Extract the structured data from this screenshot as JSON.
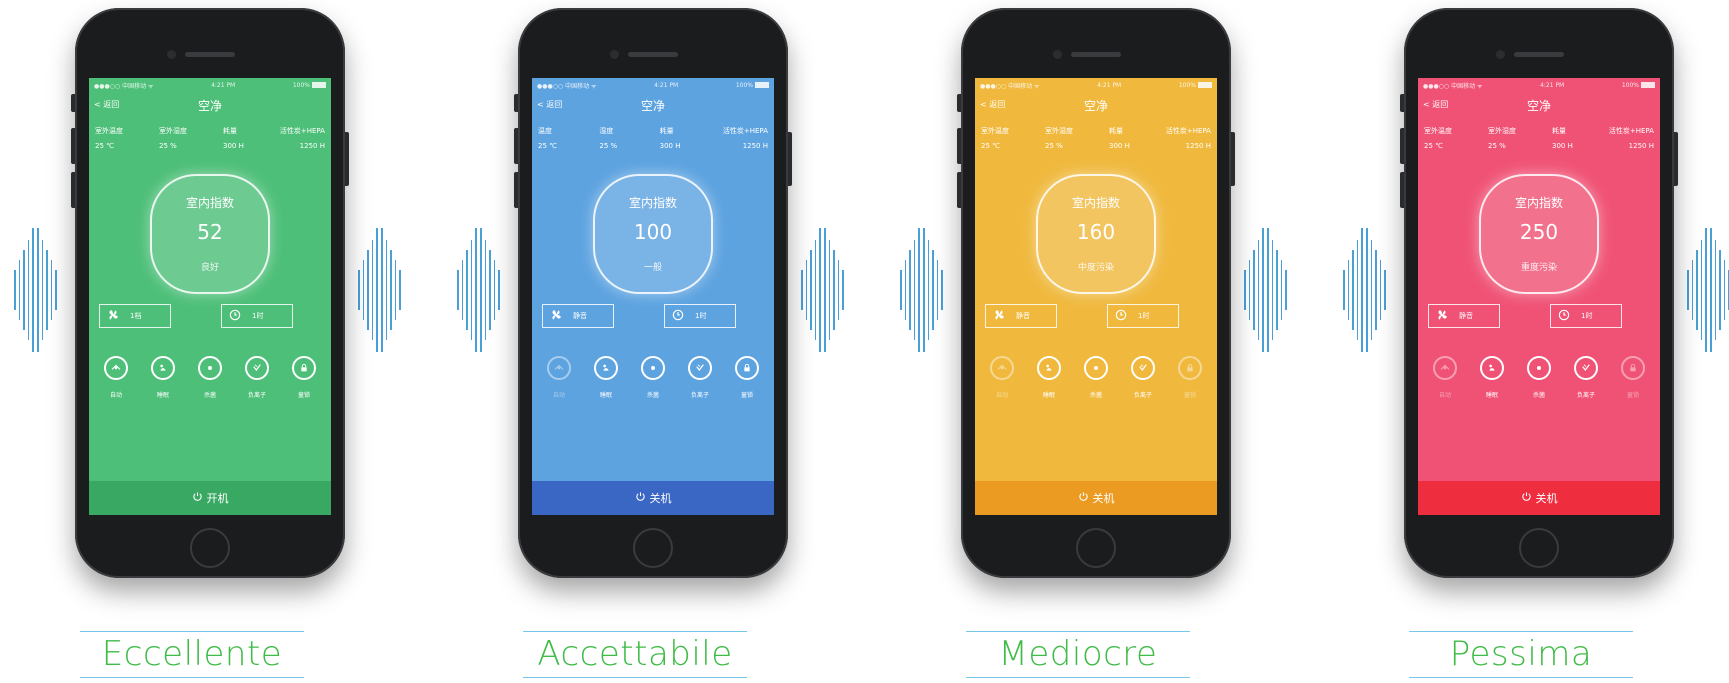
{
  "panels": [
    {
      "caption": "Eccellente",
      "theme": {
        "screen": "#4dbf78",
        "power_bar": "#39a863",
        "power_bar_text": "#ffffff"
      },
      "screen": {
        "status": {
          "carrier": "●●●○○ 中国移动 ᯤ",
          "time": "4:21 PM",
          "battery": "100%"
        },
        "back": "< 返回",
        "title": "空净",
        "stats": [
          {
            "label": "室外温度",
            "value": "25 ℃"
          },
          {
            "label": "室外湿度",
            "value": "25 %"
          },
          {
            "label": "耗量",
            "value": "300 H"
          },
          {
            "label": "活性炭+HEPA",
            "value": "1250 H"
          }
        ],
        "gauge": {
          "label": "室内指数",
          "value": "52",
          "level": "良好"
        },
        "fan_label": "1档",
        "timer_label": "1时",
        "modes": [
          {
            "label": "自动",
            "icon": "auto-icon",
            "active": true
          },
          {
            "label": "睡眠",
            "icon": "sleep-icon",
            "active": true
          },
          {
            "label": "杀菌",
            "icon": "sterilize-icon",
            "active": true
          },
          {
            "label": "负离子",
            "icon": "anion-icon",
            "active": true
          },
          {
            "label": "童锁",
            "icon": "lock-icon",
            "active": true
          }
        ],
        "power_label": "开机"
      }
    },
    {
      "caption": "Accettabile",
      "theme": {
        "screen": "#5da3e0",
        "power_bar": "#3a67c4",
        "power_bar_text": "#ffffff"
      },
      "screen": {
        "status": {
          "carrier": "●●●○○ 中国移动 ᯤ",
          "time": "4:21 PM",
          "battery": "100%"
        },
        "back": "< 返回",
        "title": "空净",
        "stats": [
          {
            "label": "温度",
            "value": "25 ℃"
          },
          {
            "label": "湿度",
            "value": "25 %"
          },
          {
            "label": "耗量",
            "value": "300 H"
          },
          {
            "label": "活性炭+HEPA",
            "value": "1250 H"
          }
        ],
        "gauge": {
          "label": "室内指数",
          "value": "100",
          "level": "一般"
        },
        "fan_label": "静音",
        "timer_label": "1时",
        "modes": [
          {
            "label": "自动",
            "icon": "auto-icon",
            "active": false
          },
          {
            "label": "睡眠",
            "icon": "sleep-icon",
            "active": true
          },
          {
            "label": "杀菌",
            "icon": "sterilize-icon",
            "active": true
          },
          {
            "label": "负离子",
            "icon": "anion-icon",
            "active": true
          },
          {
            "label": "童锁",
            "icon": "lock-icon",
            "active": true
          }
        ],
        "power_label": "关机"
      }
    },
    {
      "caption": "Mediocre",
      "theme": {
        "screen": "#f0b93e",
        "power_bar": "#eb9b22",
        "power_bar_text": "#ffffff"
      },
      "screen": {
        "status": {
          "carrier": "●●●○○ 中国移动 ᯤ",
          "time": "4:21 PM",
          "battery": "100%"
        },
        "back": "< 返回",
        "title": "空净",
        "stats": [
          {
            "label": "室外温度",
            "value": "25 ℃"
          },
          {
            "label": "室外湿度",
            "value": "25 %"
          },
          {
            "label": "耗量",
            "value": "300 H"
          },
          {
            "label": "活性炭+HEPA",
            "value": "1250 H"
          }
        ],
        "gauge": {
          "label": "室内指数",
          "value": "160",
          "level": "中度污染"
        },
        "fan_label": "静音",
        "timer_label": "1时",
        "modes": [
          {
            "label": "自动",
            "icon": "auto-icon",
            "active": false
          },
          {
            "label": "睡眠",
            "icon": "sleep-icon",
            "active": true
          },
          {
            "label": "杀菌",
            "icon": "sterilize-icon",
            "active": true
          },
          {
            "label": "负离子",
            "icon": "anion-icon",
            "active": true
          },
          {
            "label": "童锁",
            "icon": "lock-icon",
            "active": false
          }
        ],
        "power_label": "关机"
      }
    },
    {
      "caption": "Pessima",
      "theme": {
        "screen": "#f05275",
        "power_bar": "#ee2d3f",
        "power_bar_text": "#ffffff"
      },
      "screen": {
        "status": {
          "carrier": "●●●○○ 中国移动 ᯤ",
          "time": "4:21 PM",
          "battery": "100%"
        },
        "back": "< 返回",
        "title": "空净",
        "stats": [
          {
            "label": "室外温度",
            "value": "25 ℃"
          },
          {
            "label": "室外湿度",
            "value": "25 %"
          },
          {
            "label": "耗量",
            "value": "300 H"
          },
          {
            "label": "活性炭+HEPA",
            "value": "1250 H"
          }
        ],
        "gauge": {
          "label": "室内指数",
          "value": "250",
          "level": "重度污染"
        },
        "fan_label": "静音",
        "timer_label": "1时",
        "modes": [
          {
            "label": "自动",
            "icon": "auto-icon",
            "active": false
          },
          {
            "label": "睡眠",
            "icon": "sleep-icon",
            "active": true
          },
          {
            "label": "杀菌",
            "icon": "sterilize-icon",
            "active": true
          },
          {
            "label": "负离子",
            "icon": "anion-icon",
            "active": true
          },
          {
            "label": "童锁",
            "icon": "lock-icon",
            "active": false
          }
        ],
        "power_label": "关机"
      }
    }
  ],
  "decor": {
    "wave_color": "#4a9fd6",
    "caption_color": "#3fbb47",
    "caption_line_color": "#76c7e8"
  }
}
